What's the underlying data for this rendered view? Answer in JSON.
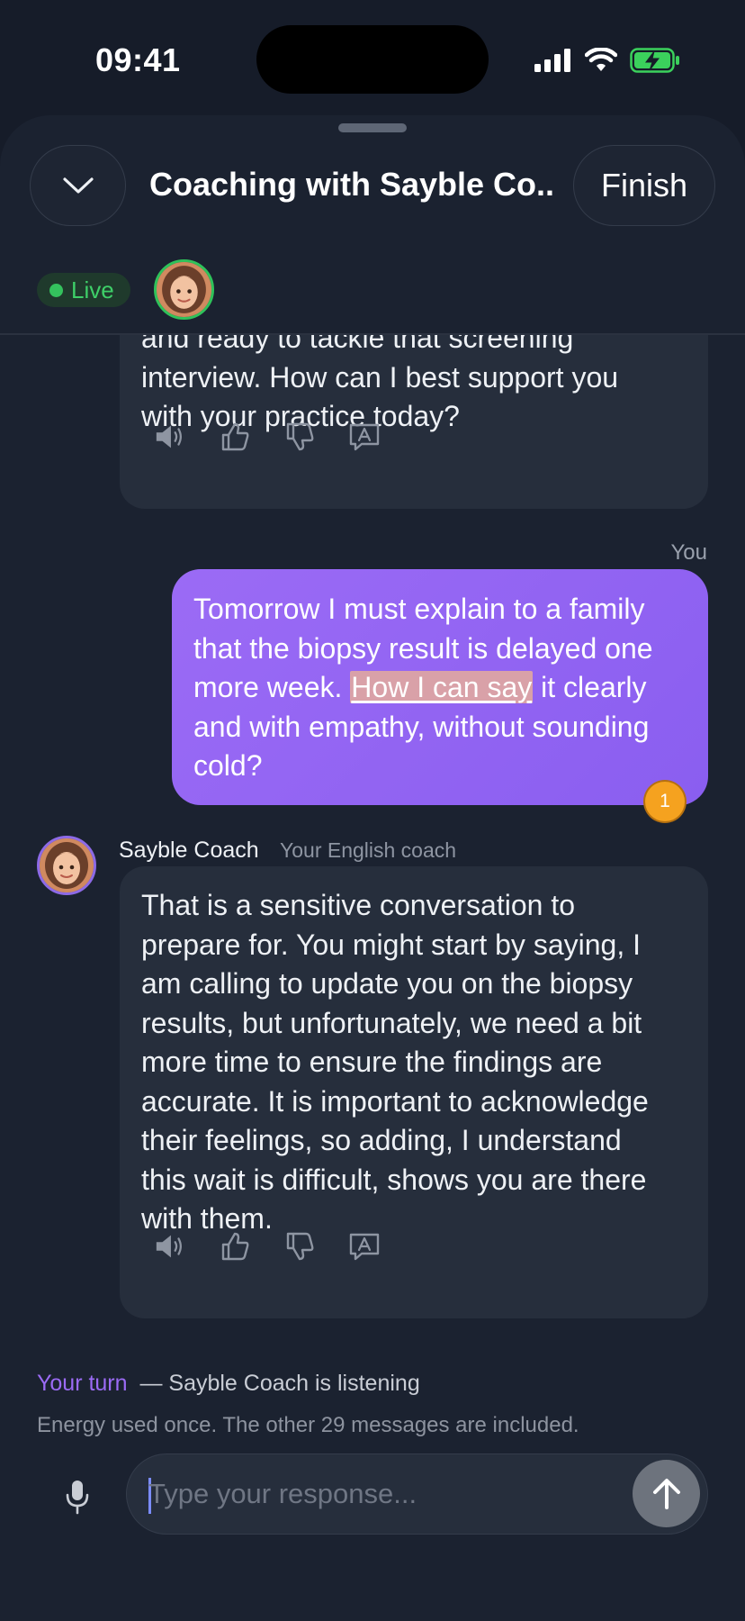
{
  "status_bar": {
    "time": "09:41"
  },
  "header": {
    "title": "Coaching with Sayble Co...",
    "finish_label": "Finish",
    "live_label": "Live"
  },
  "messages": {
    "previous_ai": {
      "lines": [
        "and ready to tackle that screening",
        "interview. How can I best support you",
        "with your practice today?"
      ]
    },
    "user": {
      "sender_label": "You",
      "text_before": "Tomorrow I must explain to a family that the biopsy result is delayed one more week. ",
      "highlight": "How I can say",
      "text_after": " it clearly and with empathy, without sounding cold?",
      "note_count": "1"
    },
    "coach": {
      "name": "Sayble Coach",
      "role": "Your English coach",
      "lines": [
        "That is a sensitive conversation to",
        "prepare for. You might start by saying, I",
        "am calling to update you on the biopsy",
        "results, but unfortunately, we need a bit",
        "more time to ensure the findings are",
        "accurate. It is important to acknowledge",
        "their feelings, so adding, I understand",
        "this wait is difficult, shows you are there",
        "with them."
      ]
    }
  },
  "footer": {
    "turn_label": "Your turn",
    "turn_rest": "— Sayble Coach is listening",
    "energy_text": "Energy used once. The other 29 messages are included.",
    "input_placeholder": "Type your response..."
  },
  "icons": {
    "speaker": "speaker-icon",
    "thumbs_up": "thumbs-up-icon",
    "thumbs_down": "thumbs-down-icon",
    "translate": "translate-icon",
    "mic": "microphone-icon",
    "send": "arrow-up-icon",
    "collapse": "chevron-down-icon"
  },
  "colors": {
    "background": "#161c29",
    "user_bubble": "#9b6bf5",
    "ai_bubble": "#262e3c",
    "live_green": "#34c25d",
    "accent_purple": "#9b6bf5",
    "note_badge": "#f5a21f"
  }
}
